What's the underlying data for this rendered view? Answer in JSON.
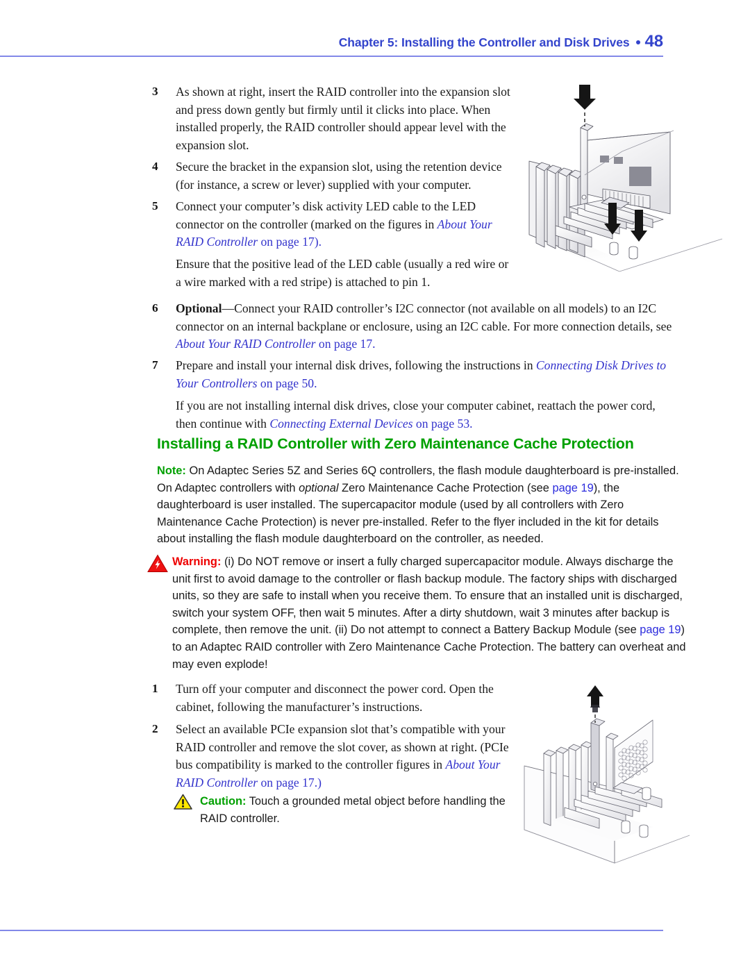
{
  "header": {
    "chapter": "Chapter 5: Installing the Controller and Disk Drives",
    "page_number": "48",
    "accent_color": "#3344cc",
    "rule_color": "#8288e8"
  },
  "colors": {
    "heading_green": "#00A000",
    "link_blue": "#3333CC",
    "warning_red": "#EE0000",
    "caution_yellow": "#FFE800",
    "body_text": "#1A1A1A"
  },
  "steps_top": [
    {
      "number": "3",
      "text": "As shown at right, insert the RAID controller into the expansion slot and press down gently but firmly until it clicks into place. When installed properly, the RAID controller should appear level with the expansion slot."
    },
    {
      "number": "4",
      "text": "Secure the bracket in the expansion slot, using the retention device (for instance, a screw or lever) supplied with your computer."
    },
    {
      "number": "5",
      "text_before": "Connect your computer’s disk activity LED cable to the LED connector on the controller (marked on the figures in ",
      "link": "About Your RAID Controller",
      "text_after": " on page 17)."
    }
  ],
  "paragraph_led": "Ensure that the positive lead of the LED cable (usually a red wire or a wire marked with a red stripe) is attached to pin 1.",
  "step6": {
    "number": "6",
    "lead": "Optional",
    "text_before": "—Connect your RAID controller’s I2C connector (not available on all models) to an I2C connector on an internal backplane or enclosure, using an I2C cable. For more connection details, see ",
    "link": "About Your RAID Controller",
    "text_after": " on page 17."
  },
  "step7": {
    "number": "7",
    "text_before": "Prepare and install your internal disk drives, following the instructions in ",
    "link": "Connecting Disk Drives to Your Controllers",
    "text_after": " on page 50."
  },
  "paragraph_cabinet": {
    "text_before": "If you are not installing internal disk drives, close your computer cabinet, reattach the power cord, then continue with ",
    "link": "Connecting External Devices",
    "text_after": " on page 53."
  },
  "section": {
    "heading": "Installing a RAID Controller with Zero Maintenance Cache Protection"
  },
  "note": {
    "label": "Note:",
    "part1": " On Adaptec Series 5Z and Series 6Q controllers, the flash module daughterboard is pre-installed. On Adaptec controllers with ",
    "italic": "optional",
    "part2": " Zero Maintenance Cache Protection (see ",
    "link": "page 19",
    "part3": "), the daughterboard is user installed. The supercapacitor module (used by all controllers with Zero Maintenance Cache Protection) is never pre-installed. Refer to the flyer included in the kit for details about installing the flash module daughterboard on the controller, as needed."
  },
  "warning": {
    "icon": "warning-triangle-bolt-icon",
    "label": "Warning:",
    "part1": " (i) Do NOT remove or insert a fully charged supercapacitor module. Always discharge the unit first to avoid damage to the controller or flash backup module. The factory ships with discharged units, so they are safe to install when you receive them. To ensure that an installed unit is discharged, switch your system OFF, then wait 5 minutes. After a dirty shutdown, wait 3 minutes after backup is complete, then remove the unit. (ii) Do not attempt to connect a Battery Backup Module (see ",
    "link": "page 19",
    "part2": ") to an Adaptec RAID controller with Zero Maintenance Cache Protection. The battery can overheat and may even explode!"
  },
  "steps_bottom": [
    {
      "number": "1",
      "text": "Turn off your computer and disconnect the power cord. Open the cabinet, following the manufacturer’s instructions."
    },
    {
      "number": "2",
      "text_before": "Select an available PCIe expansion slot that’s compatible with your RAID controller and remove the slot cover, as shown at right. (PCIe bus compatibility is marked to the controller figures in ",
      "link": "About Your RAID Controller",
      "text_after": " on page 17.)"
    }
  ],
  "caution": {
    "icon": "caution-triangle-exclamation-icon",
    "label": "Caution:",
    "text": " Touch a grounded metal object before handling the RAID controller."
  },
  "figures": {
    "top": {
      "name": "raid-controller-insertion-diagram",
      "description": "Isometric line drawing of a computer chassis expansion slot area with a RAID controller card being pressed down into a PCIe slot; black down-arrows indicate insertion direction."
    },
    "bottom": {
      "name": "slot-cover-removal-diagram",
      "description": "Isometric line drawing of a computer chassis with a blank slot cover being lifted out; a black up-arrow and a screw indicate removal direction."
    }
  }
}
